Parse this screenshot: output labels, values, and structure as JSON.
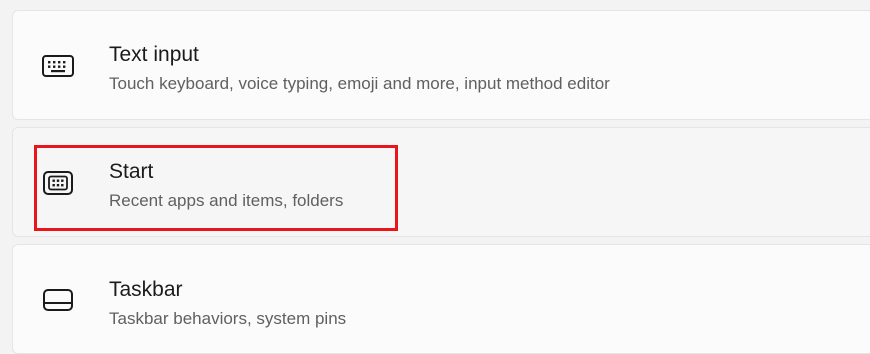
{
  "settings_items": [
    {
      "title": "Text input",
      "subtitle": "Touch keyboard, voice typing, emoji and more, input method editor",
      "icon": "keyboard-icon"
    },
    {
      "title": "Start",
      "subtitle": "Recent apps and items, folders",
      "icon": "start-menu-icon"
    },
    {
      "title": "Taskbar",
      "subtitle": "Taskbar behaviors, system pins",
      "icon": "taskbar-icon"
    }
  ],
  "annotation": {
    "highlight_color": "#e8161b",
    "highlighted_item": "Start"
  }
}
